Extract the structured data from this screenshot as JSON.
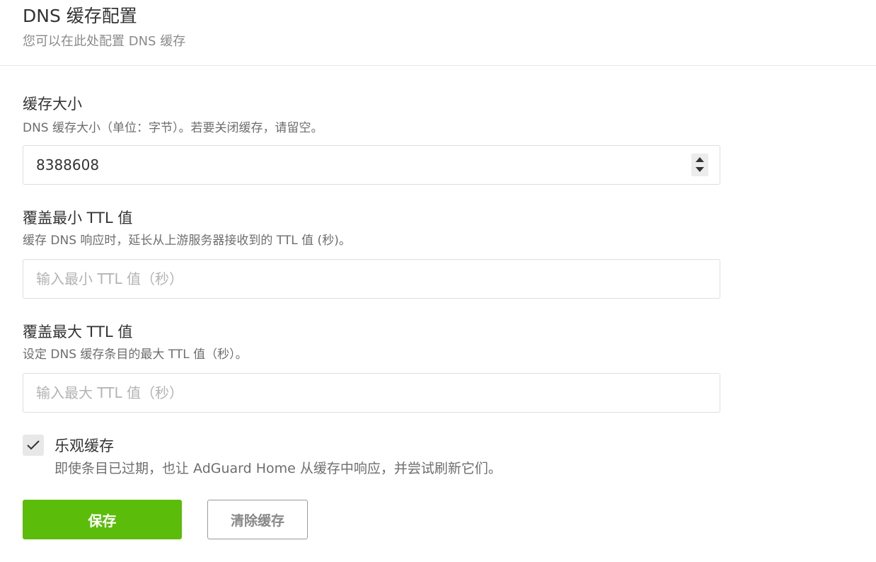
{
  "header": {
    "title": "DNS 缓存配置",
    "subtitle": "您可以在此处配置 DNS 缓存"
  },
  "cache_size": {
    "label": "缓存大小",
    "description": "DNS 缓存大小（单位：字节）。若要关闭缓存，请留空。",
    "value": "8388608"
  },
  "min_ttl": {
    "label": "覆盖最小 TTL 值",
    "description": "缓存 DNS 响应时，延长从上游服务器接收到的 TTL 值 (秒)。",
    "placeholder": "输入最小 TTL 值（秒）",
    "value": ""
  },
  "max_ttl": {
    "label": "覆盖最大 TTL 值",
    "description": "设定 DNS 缓存条目的最大 TTL 值（秒）。",
    "placeholder": "输入最大 TTL 值（秒）",
    "value": ""
  },
  "optimistic": {
    "label": "乐观缓存",
    "description": "即使条目已过期，也让 AdGuard Home 从缓存中响应，并尝试刷新它们。",
    "checked": true,
    "icon": "checkmark-icon"
  },
  "actions": {
    "save_label": "保存",
    "clear_label": "清除缓存"
  },
  "colors": {
    "primary": "#5bbc0a",
    "text": "#333333",
    "muted": "#8a8a8a",
    "border": "#dedede"
  }
}
